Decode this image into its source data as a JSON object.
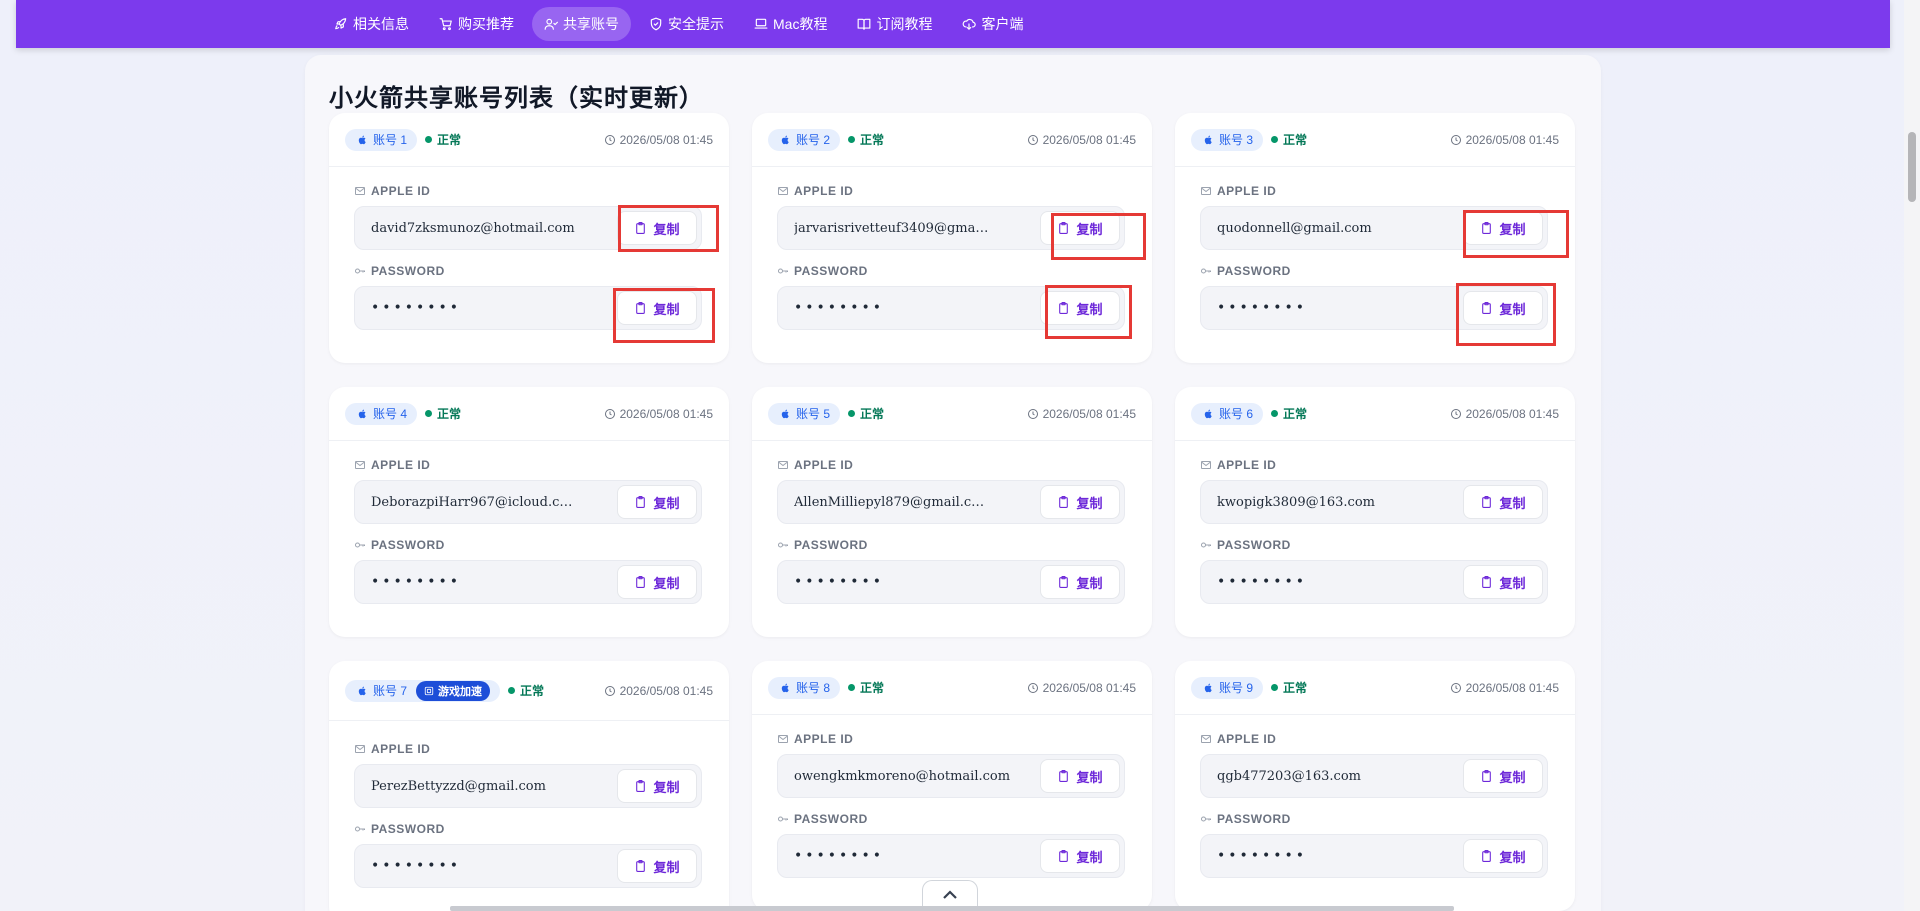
{
  "nav": {
    "items": [
      {
        "label": "相关信息",
        "icon": "rocket-icon"
      },
      {
        "label": "购买推荐",
        "icon": "cart-icon"
      },
      {
        "label": "共享账号",
        "icon": "users-icon",
        "active": true
      },
      {
        "label": "安全提示",
        "icon": "shield-icon"
      },
      {
        "label": "Mac教程",
        "icon": "laptop-icon"
      },
      {
        "label": "订阅教程",
        "icon": "book-icon"
      },
      {
        "label": "客户端",
        "icon": "download-cloud-icon"
      }
    ],
    "accent_color": "#7c3aed"
  },
  "page": {
    "title": "小火箭共享账号列表（实时更新）"
  },
  "labels": {
    "apple_id": "APPLE ID",
    "password": "PASSWORD",
    "copy": "复制",
    "status_normal": "正常",
    "game_badge": "游戏加速"
  },
  "accounts": [
    {
      "badge": "账号 1",
      "status": "正常",
      "time": "2026/05/08 01:45",
      "apple_id": "david7zksmunoz@hotmail.com",
      "password": "••••••••"
    },
    {
      "badge": "账号 2",
      "status": "正常",
      "time": "2026/05/08 01:45",
      "apple_id": "jarvarisrivetteuf3409@gma…",
      "password": "••••••••"
    },
    {
      "badge": "账号 3",
      "status": "正常",
      "time": "2026/05/08 01:45",
      "apple_id": "quodonnell@gmail.com",
      "password": "••••••••"
    },
    {
      "badge": "账号 4",
      "status": "正常",
      "time": "2026/05/08 01:45",
      "apple_id": "DeborazpiHarr967@icloud.c…",
      "password": "••••••••"
    },
    {
      "badge": "账号 5",
      "status": "正常",
      "time": "2026/05/08 01:45",
      "apple_id": "AllenMilliepyl879@gmail.c…",
      "password": "••••••••"
    },
    {
      "badge": "账号 6",
      "status": "正常",
      "time": "2026/05/08 01:45",
      "apple_id": "kwopigk3809@163.com",
      "password": "••••••••"
    },
    {
      "badge": "账号 7",
      "game_badge": "游戏加速",
      "status": "正常",
      "time": "2026/05/08 01:45",
      "apple_id": "PerezBettyzzd@gmail.com",
      "password": "••••••••"
    },
    {
      "badge": "账号 8",
      "status": "正常",
      "time": "2026/05/08 01:45",
      "apple_id": "owengkmkmoreno@hotmail.com",
      "password": "••••••••"
    },
    {
      "badge": "账号 9",
      "status": "正常",
      "time": "2026/05/08 01:45",
      "apple_id": "qgb477203@163.com",
      "password": "••••••••"
    }
  ],
  "colors": {
    "status_green": "#047857",
    "badge_blue": "#2563eb",
    "game_badge_bg": "#1d4ed8",
    "copy_purple": "#6d28d9",
    "highlight_red": "#e53935"
  }
}
